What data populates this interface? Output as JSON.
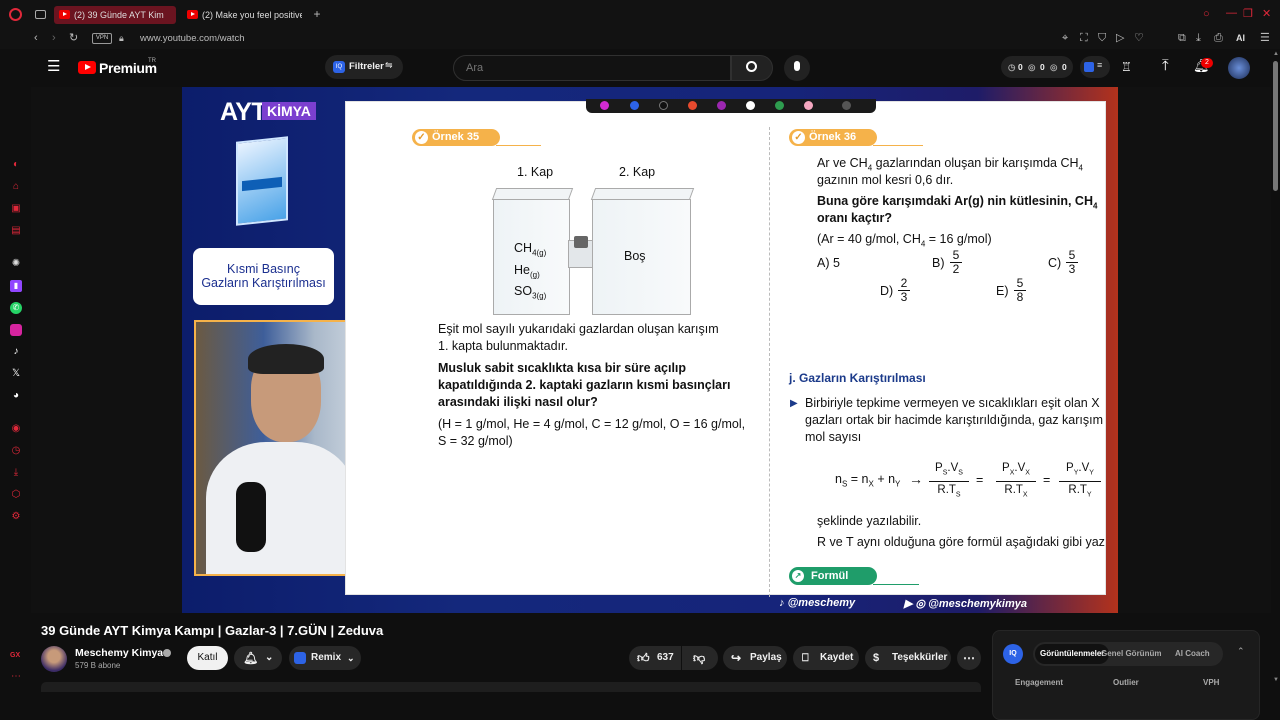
{
  "browser": {
    "tabs": [
      {
        "label": "(2) 39 Günde AYT Kim"
      },
      {
        "label": "(2) Make you feel positive"
      }
    ],
    "url": "www.youtube.com/watch",
    "vpn_badge": "VPN",
    "ai_label": "AI"
  },
  "yt": {
    "premium_label": "Premium",
    "premium_region": "TR",
    "filters_label": "Filtreler",
    "search_placeholder": "Ara",
    "stats": [
      "0",
      "0",
      "0"
    ],
    "notif_count": "2"
  },
  "video": {
    "brand_title": "AYT",
    "brand_sub": "KİMYA",
    "topic_line1": "Kısmi Basınç",
    "topic_line2": "Gazların Karıştırılması",
    "social_left": "@meschemy",
    "social_right": "@meschemykimya"
  },
  "book": {
    "ex35": {
      "badge": "Örnek 35",
      "kap1": "1. Kap",
      "kap2": "2. Kap",
      "gas1": "CH",
      "gas1_sub": "4(g)",
      "gas2": "He",
      "gas2_sub": "(g)",
      "gas3": "SO",
      "gas3_sub": "3(g)",
      "bos": "Boş",
      "text1": "Eşit mol sayılı yukarıdaki gazlardan oluşan karışım",
      "text2": "1. kapta bulunmaktadır.",
      "q1": "Musluk sabit sıcaklıkta kısa bir süre açılıp",
      "q2": "kapatıldığında 2. kaptaki gazların kısmi basınçları",
      "q3": "arasındaki ilişki nasıl olur?",
      "given1": "(H = 1 g/mol, He = 4 g/mol, C = 12 g/mol, O = 16 g/mol,",
      "given2": "S = 32 g/mol)"
    },
    "ex36": {
      "badge": "Örnek 36",
      "l1": "Ar ve CH",
      "l1_sub": "4",
      "l1_rest": " gazlarından oluşan bir karışımda CH",
      "l1_sub2": "4",
      "l2": "gazının mol kesri 0,6 dır.",
      "q1": "Buna göre karışımdaki Ar(g) nin kütlesinin, CH",
      "q1_sub": "4",
      "q2": "oranı kaçtır?",
      "given": "(Ar = 40 g/mol, CH",
      "given_sub": "4",
      "given_rest": " = 16 g/mol)",
      "a": "A) 5",
      "b": "B)",
      "b_n": "5",
      "b_d": "2",
      "c": "C)",
      "c_n": "5",
      "c_d": "3",
      "d": "D)",
      "d_n": "2",
      "d_d": "3",
      "e": "E)",
      "e_n": "5",
      "e_d": "8"
    },
    "section": {
      "title": "j. Gazların Karıştırılması",
      "p1": "Birbiriyle tepkime vermeyen ve sıcaklıkları eşit olan X",
      "p2": "gazları ortak bir hacimde karıştırıldığında, gaz karışım",
      "p3": "mol sayısı",
      "f_lhs": "n",
      "f_lhs_sub": "S",
      "f_eq": " = n",
      "f_x": "X",
      "f_plus": " + n",
      "f_y": "Y",
      "t1_n": "P",
      "t1_ns": "S",
      "t1_nm": ".V",
      "t1_ns2": "S",
      "t1_d": "R.T",
      "t1_ds": "S",
      "t2_n": "P",
      "t2_ns": "X",
      "t2_nm": ".V",
      "t2_ns2": "X",
      "t2_d": "R.T",
      "t2_ds": "X",
      "t3_n": "P",
      "t3_ns": "Y",
      "t3_nm": ".V",
      "t3_ns2": "Y",
      "t3_d": "R.T",
      "t3_ds": "Y",
      "after": "şeklinde yazılabilir.",
      "after2": "R ve T aynı olduğuna göre formül aşağıdaki gibi yaz",
      "formula_badge": "Formül"
    }
  },
  "meta": {
    "title": "39 Günde AYT Kimya Kampı | Gazlar-3 | 7.GÜN | Zeduva",
    "channel": "Meschemy Kimya",
    "subs": "579 B abone",
    "join": "Katıl",
    "remix": "Remix",
    "likes": "637",
    "share": "Paylaş",
    "save": "Kaydet",
    "thanks": "Teşekkürler"
  },
  "panel": {
    "tabs": [
      "Görüntülenmeler",
      "Genel Görünüm",
      "AI Coach"
    ],
    "cols": [
      "Engagement",
      "Outlier",
      "VPH"
    ],
    "gx": "GX"
  }
}
